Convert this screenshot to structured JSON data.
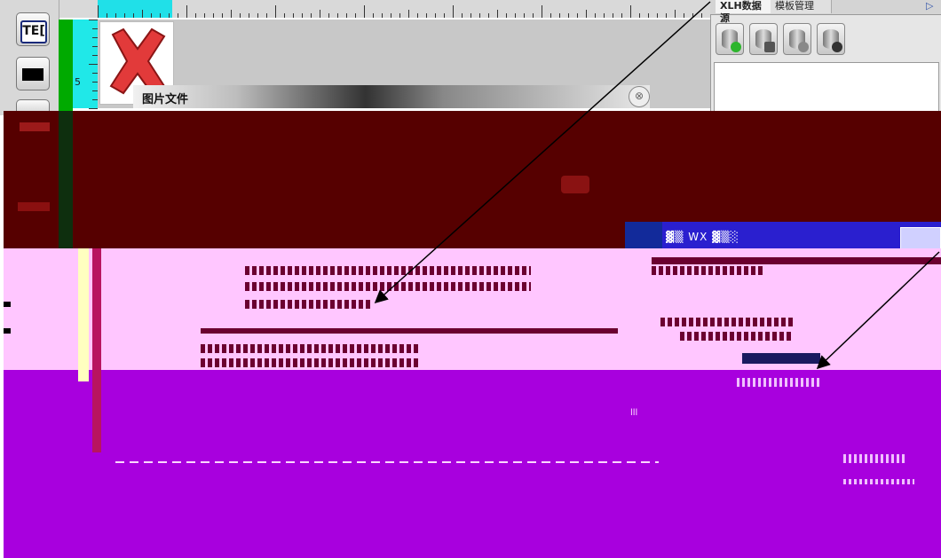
{
  "toolbar": {
    "text_tool_label": "TE[",
    "buttons": [
      "text-tool",
      "rectangle-tool",
      "more-tool"
    ]
  },
  "ruler": {
    "vertical_label": "5"
  },
  "dialog": {
    "title": "图片文件",
    "close_glyph": "⊗"
  },
  "right_panel": {
    "tabs": [
      "XLH数据源",
      "模板管理"
    ],
    "collapse_glyph": "▷",
    "db_buttons": [
      "add-database",
      "edit-database",
      "refresh-database",
      "connect-database"
    ]
  },
  "image_placeholder": {
    "icon": "red-x-broken-image-icon",
    "color": "#e23a3a"
  },
  "glitch": {
    "blue_bar_text": "▓▒ WX ▓▒░",
    "small_text": "lll"
  },
  "colors": {
    "dark_band": "#560000",
    "pink": "#ffc6ff",
    "purple": "#a800de",
    "blue": "#2a1fcf"
  }
}
